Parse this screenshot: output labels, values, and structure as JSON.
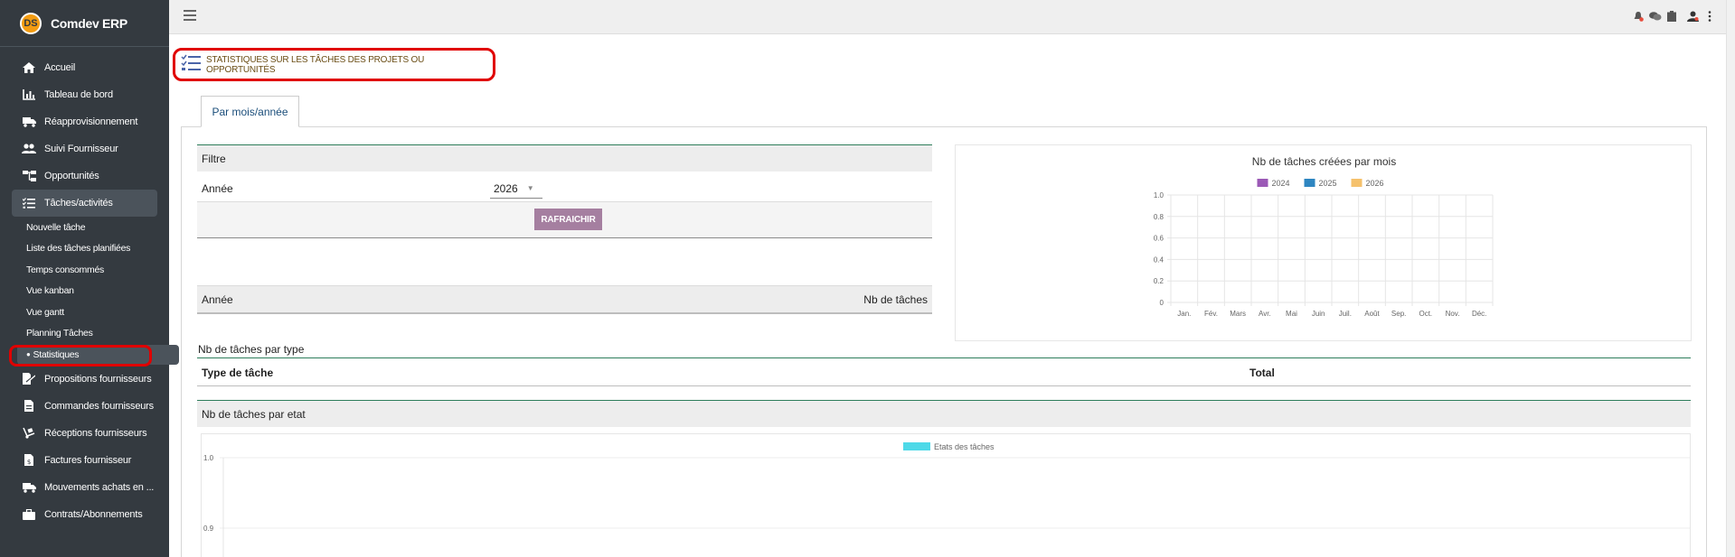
{
  "app": {
    "brand_initials": "DS",
    "brand_name": "Comdev ERP"
  },
  "sidebar": {
    "items": [
      {
        "label": "Accueil",
        "icon": "home-icon"
      },
      {
        "label": "Tableau de bord",
        "icon": "chart-icon"
      },
      {
        "label": "Réapprovisionnement",
        "icon": "truck-icon"
      },
      {
        "label": "Suivi Fournisseur",
        "icon": "users-icon"
      },
      {
        "label": "Opportunités",
        "icon": "sitemap-icon"
      },
      {
        "label": "Tâches/activités",
        "icon": "tasks-icon"
      },
      {
        "label": "Propositions fournisseurs",
        "icon": "file-signature-icon"
      },
      {
        "label": "Commandes fournisseurs",
        "icon": "file-invoice-icon"
      },
      {
        "label": "Réceptions fournisseurs",
        "icon": "dolly-icon"
      },
      {
        "label": "Factures fournisseur",
        "icon": "file-invoice-dollar-icon"
      },
      {
        "label": "Mouvements achats en ...",
        "icon": "truck-moving-icon"
      },
      {
        "label": "Contrats/Abonnements",
        "icon": "briefcase-icon"
      }
    ],
    "subitems": [
      "Nouvelle tâche",
      "Liste des tâches planifiées",
      "Temps consommés",
      "Vue kanban",
      "Vue gantt",
      "Planning Tâches",
      "Statistiques"
    ]
  },
  "page": {
    "title": "STATISTIQUES SUR LES TÂCHES DES PROJETS OU OPPORTUNITÉS",
    "tab": "Par mois/année"
  },
  "filter": {
    "header": "Filtre",
    "year_label": "Année",
    "year_value": "2026",
    "refresh_label": "RAFRAICHIR"
  },
  "year_table": {
    "col1": "Année",
    "col2": "Nb de tâches"
  },
  "type_table": {
    "title": "Nb de tâches par type",
    "col1": "Type de tâche",
    "col2": "Total"
  },
  "state_section": {
    "header": "Nb de tâches par etat"
  },
  "colors": {
    "c2024": "#9b59b6",
    "c2025": "#2e86c1",
    "c2026": "#f5c16c",
    "states": "#4dd9e8"
  },
  "chart_data": [
    {
      "type": "bar",
      "title": "Nb de tâches créées par mois",
      "categories": [
        "Jan.",
        "Fév.",
        "Mars",
        "Avr.",
        "Mai",
        "Juin",
        "Juil.",
        "Août",
        "Sep.",
        "Oct.",
        "Nov.",
        "Déc."
      ],
      "series": [
        {
          "name": "2024",
          "values": [
            0,
            0,
            0,
            0,
            0,
            0,
            0,
            0,
            0,
            0,
            0,
            0
          ]
        },
        {
          "name": "2025",
          "values": [
            0,
            0,
            0,
            0,
            0,
            0,
            0,
            0,
            0,
            0,
            0,
            0
          ]
        },
        {
          "name": "2026",
          "values": [
            0,
            0,
            0,
            0,
            0,
            0,
            0,
            0,
            0,
            0,
            0,
            0
          ]
        }
      ],
      "yticks": [
        "1.0",
        "0.8",
        "0.6",
        "0.4",
        "0.2",
        "0"
      ],
      "ylim": [
        0,
        1
      ],
      "grid": true,
      "legend": "top"
    },
    {
      "type": "bar",
      "series": [
        {
          "name": "Etats des tâches",
          "values": []
        }
      ],
      "yticks": [
        "1.0",
        "0.9"
      ],
      "grid": true,
      "legend": "top"
    }
  ]
}
